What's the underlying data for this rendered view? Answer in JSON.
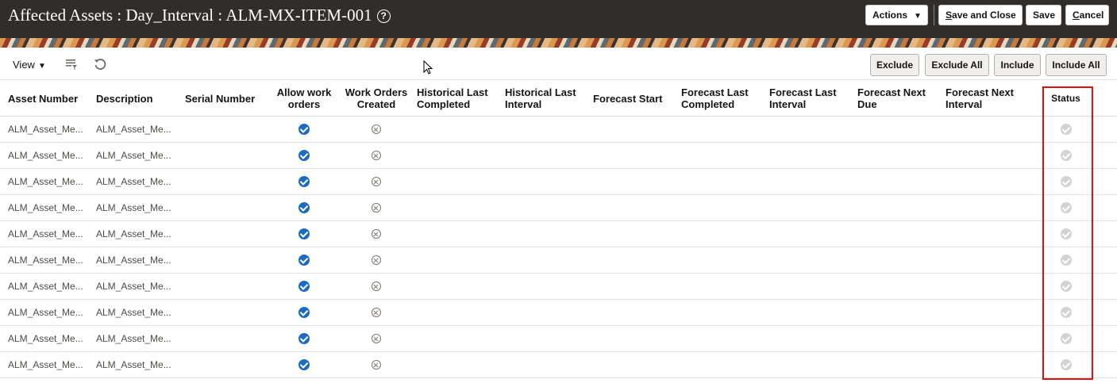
{
  "header": {
    "title": "Affected Assets : Day_Interval : ALM-MX-ITEM-001",
    "help_glyph": "?",
    "actions_label": "Actions",
    "save_close_ul": "S",
    "save_close_rest": "ave and Close",
    "save_label": "Save",
    "cancel_ul": "C",
    "cancel_rest": "ancel"
  },
  "toolbar": {
    "view_label": "View",
    "exclude_label": "Exclude",
    "exclude_all_label": "Exclude All",
    "include_label": "Include",
    "include_all_label": "Include All"
  },
  "columns": {
    "asset_number": "Asset Number",
    "description": "Description",
    "serial_number": "Serial Number",
    "allow_work_orders_1": "Allow work",
    "allow_work_orders_2": "orders",
    "work_orders_created_1": "Work Orders",
    "work_orders_created_2": "Created",
    "historical_last_completed_1": "Historical Last",
    "historical_last_completed_2": "Completed",
    "historical_last_interval_1": "Historical Last",
    "historical_last_interval_2": "Interval",
    "forecast_start": "Forecast Start",
    "forecast_last_completed_1": "Forecast Last",
    "forecast_last_completed_2": "Completed",
    "forecast_last_interval_1": "Forecast Last",
    "forecast_last_interval_2": "Interval",
    "forecast_next_due_1": "Forecast Next",
    "forecast_next_due_2": "Due",
    "forecast_next_interval_1": "Forecast Next",
    "forecast_next_interval_2": "Interval",
    "status": "Status"
  },
  "rows": [
    {
      "asset_number": "ALM_Asset_Me...",
      "description": "ALM_Asset_Me...",
      "allow_work_orders": true,
      "work_orders_created": false,
      "status": "complete"
    },
    {
      "asset_number": "ALM_Asset_Me...",
      "description": "ALM_Asset_Me...",
      "allow_work_orders": true,
      "work_orders_created": false,
      "status": "complete"
    },
    {
      "asset_number": "ALM_Asset_Me...",
      "description": "ALM_Asset_Me...",
      "allow_work_orders": true,
      "work_orders_created": false,
      "status": "complete"
    },
    {
      "asset_number": "ALM_Asset_Me...",
      "description": "ALM_Asset_Me...",
      "allow_work_orders": true,
      "work_orders_created": false,
      "status": "complete"
    },
    {
      "asset_number": "ALM_Asset_Me...",
      "description": "ALM_Asset_Me...",
      "allow_work_orders": true,
      "work_orders_created": false,
      "status": "complete"
    },
    {
      "asset_number": "ALM_Asset_Me...",
      "description": "ALM_Asset_Me...",
      "allow_work_orders": true,
      "work_orders_created": false,
      "status": "complete"
    },
    {
      "asset_number": "ALM_Asset_Me...",
      "description": "ALM_Asset_Me...",
      "allow_work_orders": true,
      "work_orders_created": false,
      "status": "complete"
    },
    {
      "asset_number": "ALM_Asset_Me...",
      "description": "ALM_Asset_Me...",
      "allow_work_orders": true,
      "work_orders_created": false,
      "status": "complete"
    },
    {
      "asset_number": "ALM_Asset_Me...",
      "description": "ALM_Asset_Me...",
      "allow_work_orders": true,
      "work_orders_created": false,
      "status": "complete"
    },
    {
      "asset_number": "ALM_Asset_Me...",
      "description": "ALM_Asset_Me...",
      "allow_work_orders": true,
      "work_orders_created": false,
      "status": "complete"
    }
  ],
  "colors": {
    "header_bg": "#312d2a",
    "check_blue": "#1b6bc0",
    "highlight_red": "#e01010",
    "status_gray": "#d5d3d1"
  },
  "icons": {
    "allow_yes": "check-circle-icon",
    "created_no": "x-circle-icon",
    "status": "status-check-icon",
    "filter": "filter-icon",
    "reset": "reset-icon"
  }
}
